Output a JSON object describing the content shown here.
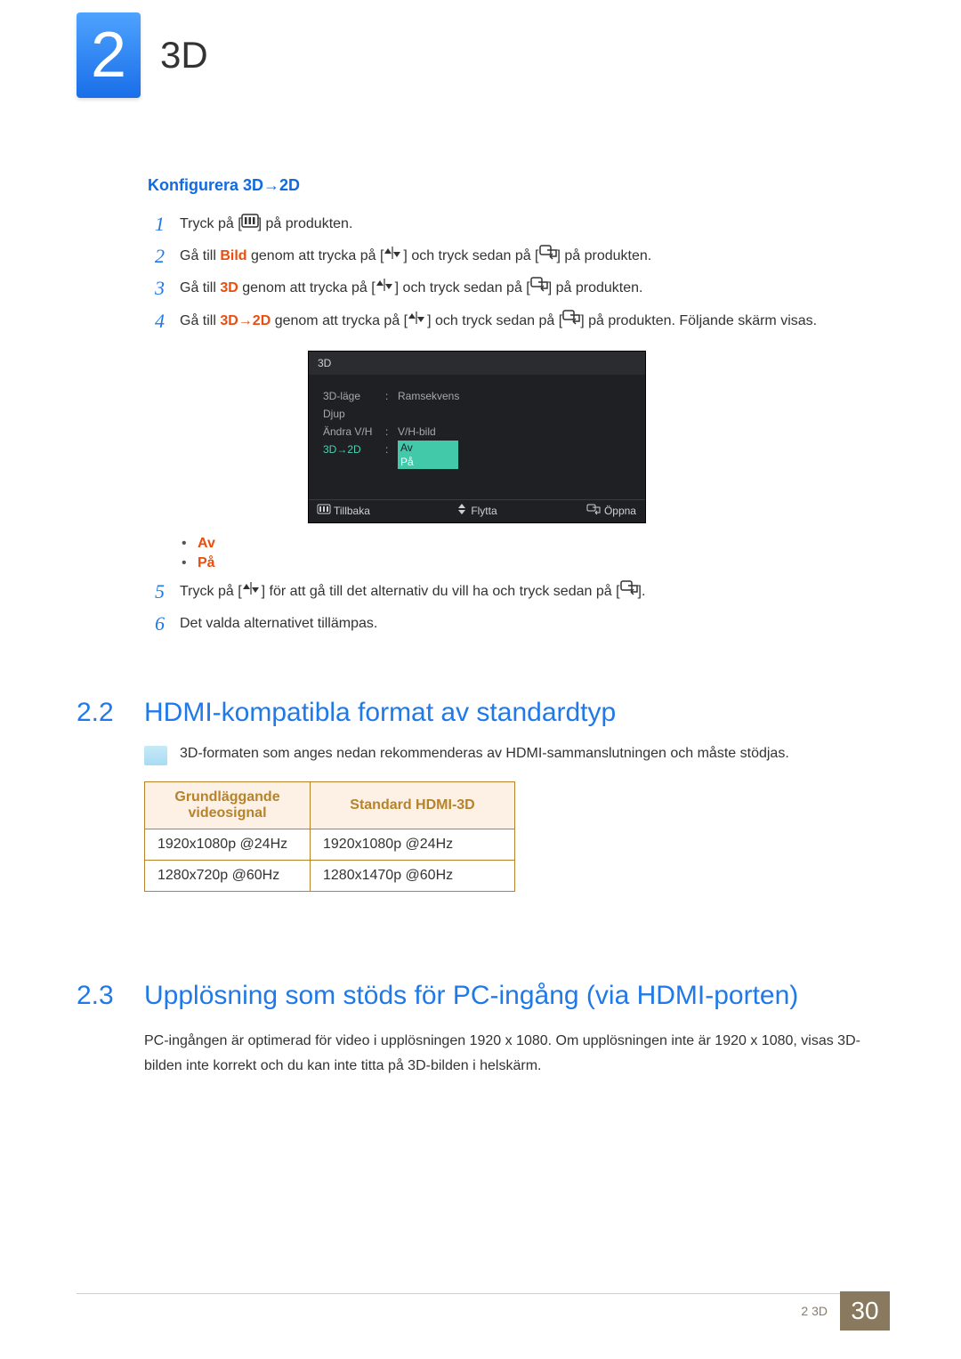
{
  "chapter": {
    "number": "2",
    "title": "3D"
  },
  "subhead1": "Konfigurera 3D→2D",
  "steps": {
    "s1": {
      "num": "1",
      "a": "Tryck på [",
      "b": "] på produkten."
    },
    "s2": {
      "num": "2",
      "a": "Gå till ",
      "bold": "Bild",
      "b": " genom att trycka på [",
      "c": "] och tryck sedan på [",
      "d": "] på produkten."
    },
    "s3": {
      "num": "3",
      "a": "Gå till ",
      "bold": "3D",
      "b": " genom att trycka på [",
      "c": "] och tryck sedan på [",
      "d": "] på produkten."
    },
    "s4": {
      "num": "4",
      "a": "Gå till ",
      "bold": "3D→2D",
      "b": " genom att trycka på [",
      "c": "] och tryck sedan på [",
      "d": "] på produkten. Följande skärm visas."
    },
    "s5": {
      "num": "5",
      "a": "Tryck på [",
      "b": "] för att gå till det alternativ du vill ha och tryck sedan på [",
      "c": "]."
    },
    "s6": {
      "num": "6",
      "a": "Det valda alternativet tillämpas."
    }
  },
  "osd": {
    "title": "3D",
    "rows": {
      "r1": {
        "label": "3D-läge",
        "value": "Ramsekvens"
      },
      "r2": {
        "label": "Djup",
        "value": ""
      },
      "r3": {
        "label": "Ändra V/H",
        "value": "V/H-bild"
      },
      "r4": {
        "label": "3D→2D",
        "value": ""
      }
    },
    "options": {
      "o1": "Av",
      "o2": "På"
    },
    "footer": {
      "back": "Tillbaka",
      "move": "Flytta",
      "open": "Öppna"
    }
  },
  "bullets": {
    "b1": "Av",
    "b2": "På"
  },
  "section22": {
    "num": "2.2",
    "title": "HDMI-kompatibla format av standardtyp"
  },
  "note22": "3D-formaten som anges nedan rekommenderas av HDMI-sammanslutningen och måste stödjas.",
  "table22": {
    "head": {
      "c1": "Grundläggande videosignal",
      "c2": "Standard HDMI-3D"
    },
    "rows": [
      {
        "c1": "1920x1080p @24Hz",
        "c2": "1920x1080p @24Hz"
      },
      {
        "c1": "1280x720p @60Hz",
        "c2": "1280x1470p @60Hz"
      }
    ]
  },
  "section23": {
    "num": "2.3",
    "title": "Upplösning som stöds för PC-ingång (via HDMI-porten)"
  },
  "para23": "PC-ingången är optimerad för video i upplösningen 1920 x 1080. Om upplösningen inte är 1920 x 1080, visas 3D-bilden inte korrekt och du kan inte titta på 3D-bilden i helskärm.",
  "footer": {
    "section": "2 3D",
    "page": "30"
  },
  "chart_data": {
    "type": "table",
    "title": "HDMI-kompatibla format av standardtyp",
    "columns": [
      "Grundläggande videosignal",
      "Standard HDMI-3D"
    ],
    "rows": [
      [
        "1920x1080p @24Hz",
        "1920x1080p @24Hz"
      ],
      [
        "1280x720p @60Hz",
        "1280x1470p @60Hz"
      ]
    ]
  }
}
